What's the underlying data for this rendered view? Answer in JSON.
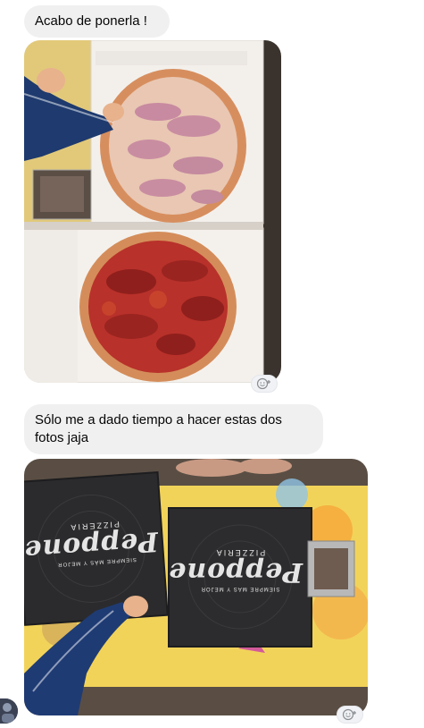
{
  "conversation": {
    "messages": [
      {
        "type": "text",
        "text": "Acabo de ponerla !"
      },
      {
        "type": "photo",
        "description": "two pizzas in takeaway boxes"
      },
      {
        "type": "text",
        "text": "Sólo me a dado tiempo a hacer estas dos fotos jaja"
      },
      {
        "type": "photo",
        "description": "two closed pizza boxes"
      }
    ]
  },
  "photo2": {
    "box_left": {
      "brand_small": "PIZZERIA",
      "brand_big": "Peppone",
      "tagline": "SIEMPRE MÁS Y MEJOR"
    },
    "box_right": {
      "brand_small": "PIZZERIA",
      "brand_big": "Peppone",
      "tagline": "SIEMPRE MÁS Y MEJOR"
    }
  },
  "icons": {
    "reaction": "smiley-plus-icon",
    "avatar": "user-avatar"
  },
  "colors": {
    "bubble_bg": "#f0f0f0",
    "text": "#050505",
    "pizza_box_dark": "#2b2b2d",
    "table_yellow": "#f2d35a"
  }
}
